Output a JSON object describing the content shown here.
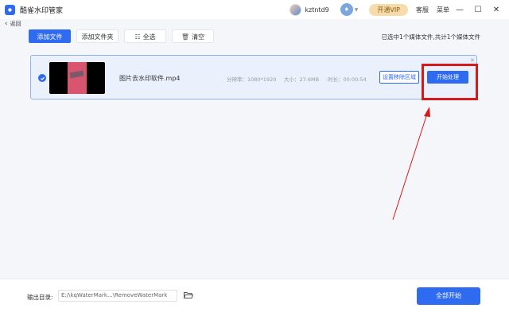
{
  "titlebar": {
    "app_title": "酷雀水印管家",
    "username": "kztntd9",
    "vip_button": "开通VIP",
    "service": "客服",
    "menu": "菜单",
    "minimize": "—",
    "maximize": "☐",
    "close": "✕"
  },
  "nav": {
    "back_label": "返回",
    "back_icon": "‹"
  },
  "toolbar": {
    "add_file": "添加文件",
    "add_folder": "添加文件夹",
    "select_all": "全选",
    "clear": "清空",
    "select_all_icon": "☷",
    "clear_icon": "🗑",
    "selection_summary": "已选中1个媒体文件,共计1个媒体文件"
  },
  "file": {
    "name": "图片去水印软件.mp4",
    "resolution": "分辨率：1080*1920",
    "size": "大小：27.6MB",
    "duration": "时长：00:00:54",
    "set_region_button": "设置移除区域",
    "start_button": "开始处理",
    "close_icon": "✕"
  },
  "footer": {
    "output_label": "输出目录:",
    "output_path": "E:/\\kqWaterMark...\\RemoveWaterMark",
    "start_all_button": "全部开始"
  },
  "colors": {
    "accent": "#2f6bf0",
    "annotation": "#d61a1a",
    "vip": "#f6dcaa"
  },
  "icons": {
    "app_logo": "app-logo-icon",
    "check": "check-circle-icon",
    "folder": "folder-open-icon",
    "arrow": "annotation-arrow"
  }
}
